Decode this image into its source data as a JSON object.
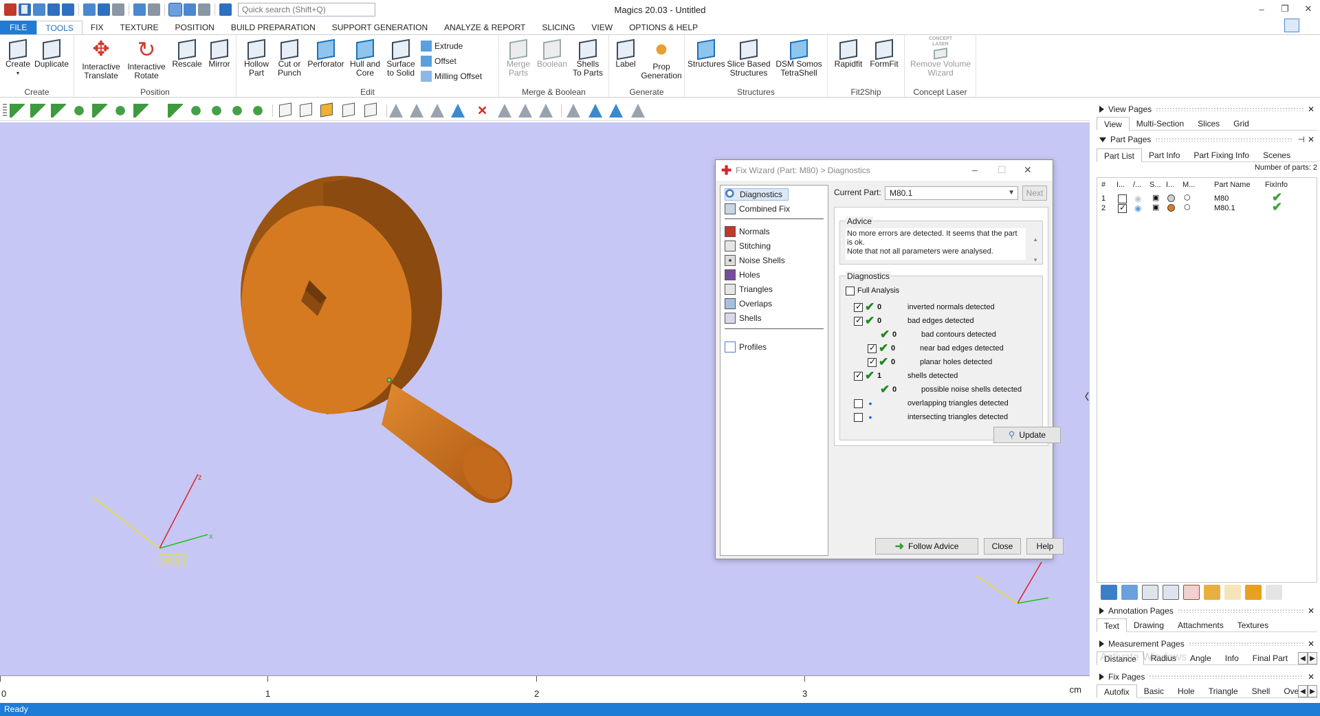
{
  "app": {
    "title": "Magics 20.03 - Untitled",
    "search_placeholder": "Quick search (Shift+Q)",
    "status": "Ready"
  },
  "ribbon_tabs": [
    "FILE",
    "TOOLS",
    "FIX",
    "TEXTURE",
    "POSITION",
    "BUILD PREPARATION",
    "SUPPORT GENERATION",
    "ANALYZE & REPORT",
    "SLICING",
    "VIEW",
    "OPTIONS & HELP"
  ],
  "ribbon": {
    "create": {
      "label": "Create",
      "buttons": [
        "Create",
        "Duplicate"
      ]
    },
    "position": {
      "label": "Position",
      "buttons": [
        "Interactive\nTranslate",
        "Interactive\nRotate",
        "Rescale",
        "Mirror"
      ]
    },
    "edit": {
      "label": "Edit",
      "buttons": [
        "Hollow\nPart",
        "Cut or\nPunch",
        "Perforator",
        "Hull and\nCore",
        "Surface\nto Solid"
      ],
      "small": [
        "Extrude",
        "Offset",
        "Milling Offset"
      ]
    },
    "merge": {
      "label": "Merge & Boolean",
      "buttons": [
        "Merge\nParts",
        "Boolean",
        "Shells\nTo Parts"
      ]
    },
    "generate": {
      "label": "Generate",
      "buttons": [
        "Label",
        "Prop\nGeneration"
      ]
    },
    "structures": {
      "label": "Structures",
      "buttons": [
        "Structures",
        "Slice Based\nStructures",
        "DSM Somos\nTetraShell"
      ]
    },
    "fit2ship": {
      "label": "Fit2Ship",
      "buttons": [
        "Rapidfit",
        "FormFit"
      ]
    },
    "concept": {
      "label": "Concept Laser",
      "buttons": [
        "Remove Volume\nWizard"
      ],
      "logo_text": "CONCEPT\nLASER"
    }
  },
  "viewport": {
    "axis_labels": {
      "z": "z",
      "x": "x",
      "wcs": "WCS"
    },
    "colors": {
      "background": "#c7c7f5",
      "part": "#d67a22"
    }
  },
  "ruler": {
    "numbers": [
      "0",
      "1",
      "2",
      "3"
    ],
    "unit": "cm"
  },
  "fix_wizard": {
    "title": "Fix Wizard (Part: M80) > Diagnostics",
    "nav_top": [
      "Diagnostics",
      "Combined Fix"
    ],
    "nav_mid": [
      "Normals",
      "Stitching",
      "Noise Shells",
      "Holes",
      "Triangles",
      "Overlaps",
      "Shells"
    ],
    "nav_bottom": [
      "Profiles"
    ],
    "current_part_label": "Current Part:",
    "current_part_value": "M80.1",
    "next_label": "Next",
    "advice_title": "Advice",
    "advice_text": "No more errors are detected. It seems that the part is ok.\nNote that not all parameters were analysed.",
    "diagnostics_title": "Diagnostics",
    "full_analysis_label": "Full Analysis",
    "rows": [
      {
        "count": "0",
        "text": "inverted normals detected"
      },
      {
        "count": "0",
        "text": "bad edges detected"
      },
      {
        "count": "0",
        "text": "bad contours detected"
      },
      {
        "count": "0",
        "text": "near bad edges detected"
      },
      {
        "count": "0",
        "text": "planar holes detected"
      },
      {
        "count": "1",
        "text": "shells detected"
      },
      {
        "count": "0",
        "text": "possible noise shells detected"
      },
      {
        "count": "",
        "text": "overlapping triangles detected"
      },
      {
        "count": "",
        "text": "intersecting triangles detected"
      }
    ],
    "update_label": "Update",
    "follow_advice_label": "Follow Advice",
    "close_label": "Close",
    "help_label": "Help"
  },
  "right_panel": {
    "view_pages": {
      "title": "View Pages",
      "tabs": [
        "View",
        "Multi-Section",
        "Slices",
        "Grid"
      ]
    },
    "part_pages": {
      "title": "Part Pages",
      "tabs": [
        "Part List",
        "Part Info",
        "Part Fixing Info",
        "Scenes"
      ],
      "count_text": "Number of parts: 2",
      "headers": [
        "#",
        "I...",
        "/...",
        "S...",
        "I...",
        "M...",
        "Part Name",
        "FixInfo"
      ],
      "rows": [
        {
          "num": "1",
          "name": "M80"
        },
        {
          "num": "2",
          "name": "M80.1"
        }
      ]
    },
    "annotation_pages": {
      "title": "Annotation Pages",
      "tabs": [
        "Text",
        "Drawing",
        "Attachments",
        "Textures"
      ]
    },
    "measurement_pages": {
      "title": "Measurement Pages",
      "tabs": [
        "Distance",
        "Radius",
        "Angle",
        "Info",
        "Final Part"
      ]
    },
    "fix_pages": {
      "title": "Fix Pages",
      "tabs": [
        "Autofix",
        "Basic",
        "Hole",
        "Triangle",
        "Shell",
        "Over"
      ]
    },
    "watermark": "Activate Windows"
  }
}
